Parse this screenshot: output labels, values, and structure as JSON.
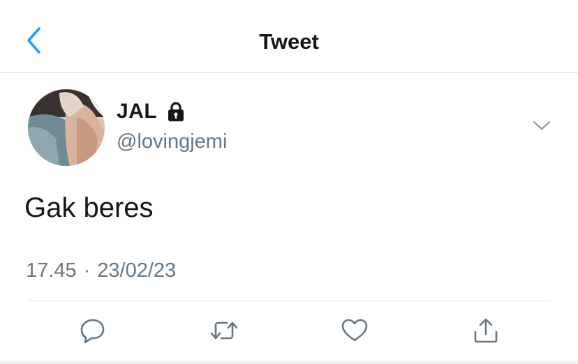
{
  "navbar": {
    "title": "Tweet",
    "back_icon": "chevron-left-icon",
    "accent_color": "#1da1f2"
  },
  "tweet": {
    "display_name": "JAL",
    "protected_icon": "lock-icon",
    "handle": "@lovingjemi",
    "text": "Gak beres",
    "time": "17.45",
    "separator": "·",
    "date": "23/02/23"
  },
  "actions": {
    "reply_icon": "reply-icon",
    "retweet_icon": "retweet-icon",
    "like_icon": "heart-icon",
    "share_icon": "share-icon"
  },
  "colors": {
    "text_primary": "#14171a",
    "text_secondary": "#657786",
    "divider": "#dfe3e6"
  }
}
